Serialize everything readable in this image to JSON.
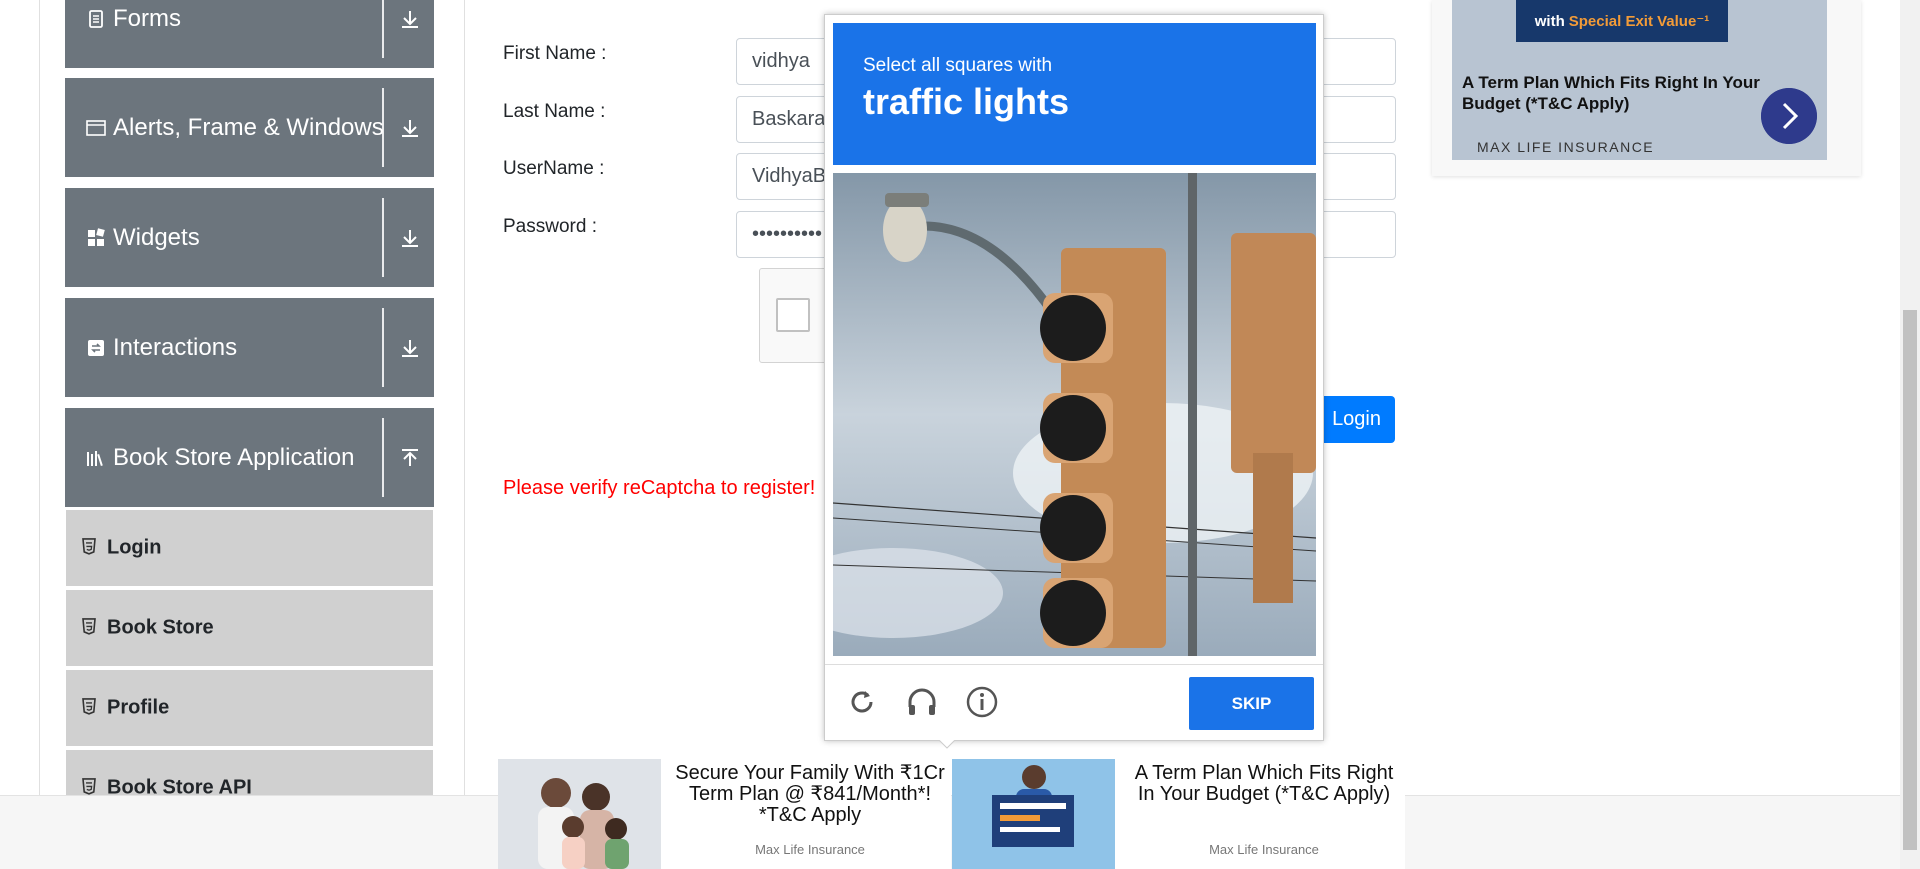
{
  "sidebar": {
    "groups": [
      {
        "label": "Forms",
        "icon": "document-icon"
      },
      {
        "label": "Alerts, Frame & Windows",
        "icon": "window-icon"
      },
      {
        "label": "Widgets",
        "icon": "widgets-icon"
      },
      {
        "label": "Interactions",
        "icon": "interactions-icon"
      },
      {
        "label": "Book Store Application",
        "icon": "books-icon"
      }
    ],
    "items": [
      {
        "label": "Login"
      },
      {
        "label": "Book Store"
      },
      {
        "label": "Profile"
      },
      {
        "label": "Book Store API"
      }
    ]
  },
  "form": {
    "first_name_label": "First Name :",
    "first_name_value": "vidhya",
    "last_name_label": "Last Name :",
    "last_name_value": "Baskaran",
    "username_label": "UserName :",
    "username_value": "VidhyaB",
    "password_label": "Password :",
    "password_value": "••••••••••",
    "login_button": "Login",
    "error": "Please verify reCaptcha to register!"
  },
  "captcha": {
    "instruction": "Select all squares with",
    "target": "traffic lights",
    "skip_label": "SKIP",
    "header_color": "#1a73e8"
  },
  "ad_right": {
    "banner_prefix": "with",
    "banner_highlight": "Special Exit Value⁻¹",
    "text": "A Term Plan Which Fits Right In Your Budget (*T&C Apply)",
    "brand": "MAX LIFE INSURANCE"
  },
  "ad_bottom": [
    {
      "title": "Secure Your Family With ₹1Cr Term Plan @ ₹841/Month*! *T&C Apply",
      "brand": "Max Life Insurance"
    },
    {
      "title": "A Term Plan Which Fits Right In Your Budget (*T&C Apply)",
      "brand": "Max Life Insurance"
    }
  ]
}
